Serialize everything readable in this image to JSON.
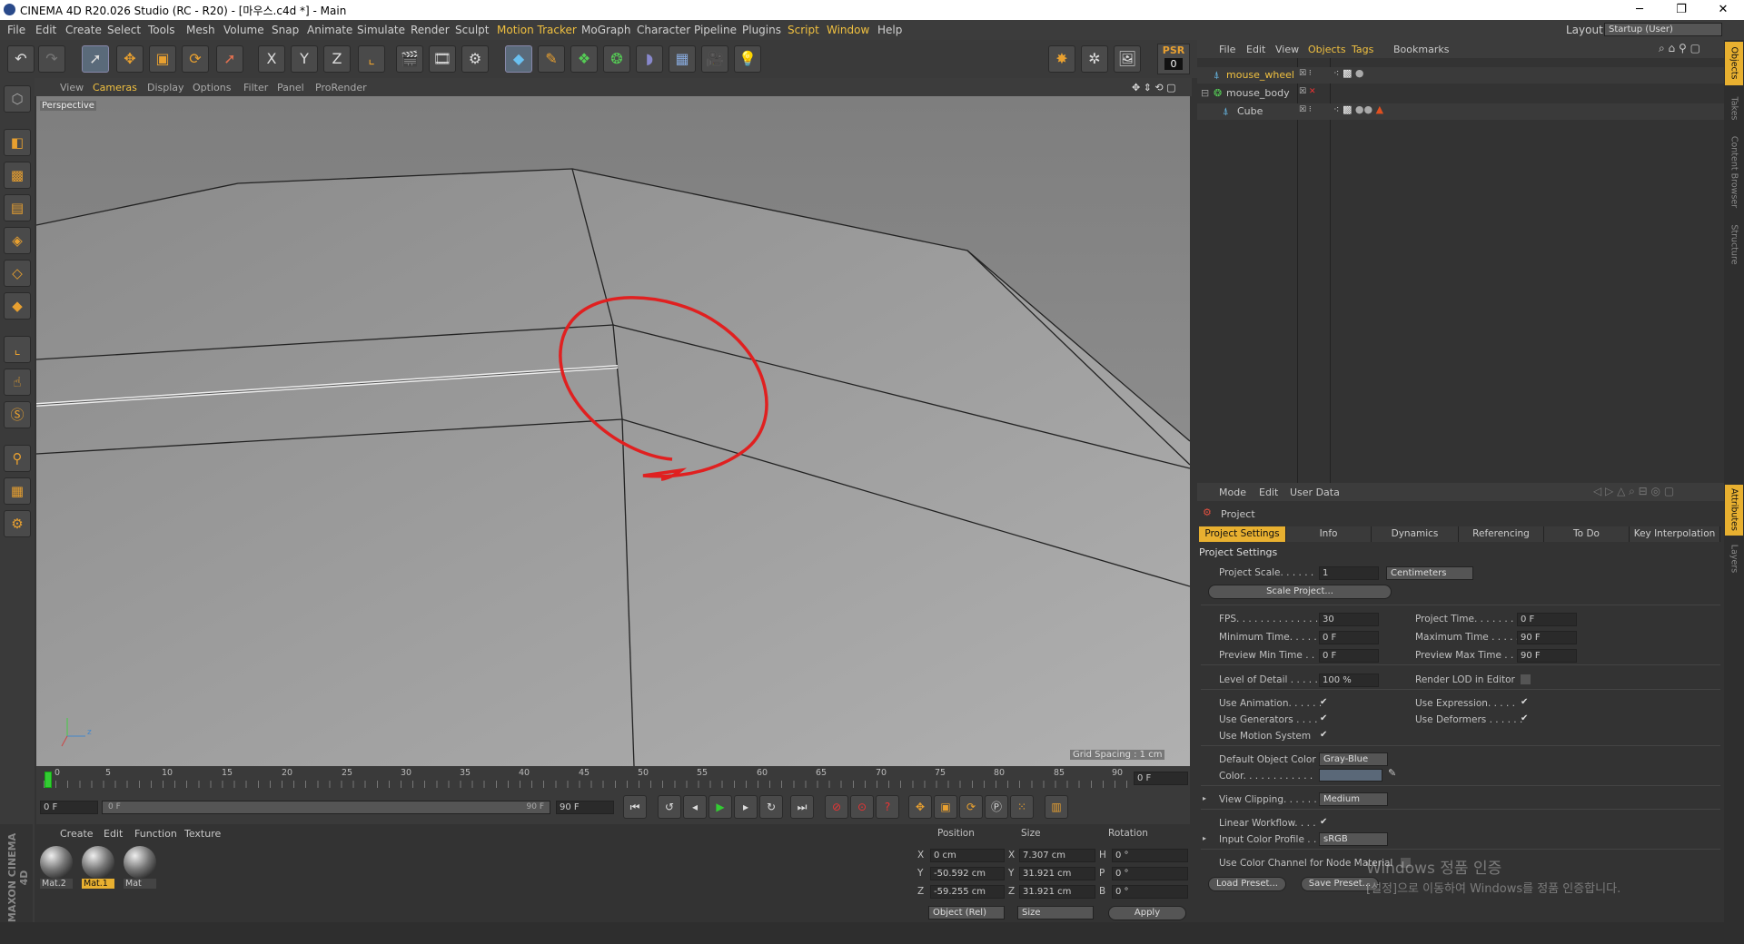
{
  "window": {
    "title": "CINEMA 4D R20.026 Studio (RC - R20) - [마우스.c4d *] - Main",
    "controls": [
      "─",
      "❐",
      "✕"
    ]
  },
  "menu": {
    "items": [
      "File",
      "Edit",
      "Create",
      "Select",
      "Tools",
      "Mesh",
      "Volume",
      "Snap",
      "Animate",
      "Simulate",
      "Render",
      "Sculpt",
      "Motion Tracker",
      "MoGraph",
      "Character",
      "Pipeline",
      "Plugins",
      "Script",
      "Window",
      "Help"
    ],
    "layout_label": "Layout:",
    "layout_value": "Startup (User)"
  },
  "toolbar": {
    "buttons": [
      "undo",
      "redo",
      "live-selection",
      "move",
      "scale",
      "rotate",
      "recent-tool",
      "x-axis",
      "y-axis",
      "z-axis",
      "coordinate-system",
      "render-view",
      "render-picture-viewer",
      "edit-render-settings",
      "cube",
      "pen",
      "subdivision",
      "array",
      "deformer",
      "floor",
      "camera",
      "light"
    ],
    "axis_labels": [
      "X",
      "Y",
      "Z"
    ],
    "psr_label": "PSR",
    "psr_value": "0"
  },
  "viewport": {
    "menu": [
      "View",
      "Cameras",
      "Display",
      "Options",
      "Filter",
      "Panel",
      "ProRender"
    ],
    "camera": "Perspective",
    "grid_spacing": "Grid Spacing : 1 cm",
    "axis_z": "z"
  },
  "timeline": {
    "ticks": [
      "0",
      "5",
      "10",
      "15",
      "20",
      "25",
      "30",
      "35",
      "40",
      "45",
      "50",
      "55",
      "60",
      "65",
      "70",
      "75",
      "80",
      "85",
      "90"
    ],
    "current": "0 F",
    "start": "0 F",
    "range_start": "0 F",
    "range_end": "90 F",
    "end": "90 F"
  },
  "materials": {
    "menu": [
      "Create",
      "Edit",
      "Function",
      "Texture"
    ],
    "items": [
      {
        "name": "Mat.2",
        "selected": false
      },
      {
        "name": "Mat.1",
        "selected": true
      },
      {
        "name": "Mat",
        "selected": false
      }
    ],
    "brand": "MAXON CINEMA 4D"
  },
  "coords": {
    "headers": [
      "Position",
      "Size",
      "Rotation"
    ],
    "rows": [
      {
        "axis": "X",
        "pos": "0 cm",
        "saxis": "X",
        "size": "7.307 cm",
        "raxis": "H",
        "rot": "0 °"
      },
      {
        "axis": "Y",
        "pos": "-50.592 cm",
        "saxis": "Y",
        "size": "31.921 cm",
        "raxis": "P",
        "rot": "0 °"
      },
      {
        "axis": "Z",
        "pos": "-59.255 cm",
        "saxis": "Z",
        "size": "31.921 cm",
        "raxis": "B",
        "rot": "0 °"
      }
    ],
    "mode": "Object (Rel)",
    "size_mode": "Size",
    "apply": "Apply"
  },
  "objects": {
    "menu": [
      "File",
      "Edit",
      "View",
      "Objects",
      "Tags",
      "Bookmarks"
    ],
    "rows": [
      {
        "name": "mouse_wheel",
        "color": "#f0c040",
        "indent": 0
      },
      {
        "name": "mouse_body",
        "color": "#c8c8c8",
        "indent": 0
      },
      {
        "name": "Cube",
        "color": "#c8c8c8",
        "indent": 1
      }
    ]
  },
  "attributes": {
    "menu": [
      "Mode",
      "Edit",
      "User Data"
    ],
    "title": "Project",
    "tabs": [
      "Project Settings",
      "Info",
      "Dynamics",
      "Referencing",
      "To Do",
      "Key Interpolation"
    ],
    "section": "Project Settings",
    "project_scale_label": "Project Scale. . . . . .",
    "project_scale": "1",
    "units": "Centimeters",
    "scale_project": "Scale Project...",
    "fps_label": "FPS. . . . . . . . . . . . . . .",
    "fps": "30",
    "project_time_label": "Project Time. . . . . . . .",
    "project_time": "0 F",
    "min_time_label": "Minimum Time. . . . .",
    "min_time": "0 F",
    "max_time_label": "Maximum Time . . . . .",
    "max_time": "90 F",
    "prev_min_label": "Preview Min Time . .",
    "prev_min": "0 F",
    "prev_max_label": "Preview Max Time . . .",
    "prev_max": "90 F",
    "lod_label": "Level of Detail . . . . .",
    "lod": "100 %",
    "render_lod_label": "Render LOD in Editor",
    "use_anim_label": "Use Animation. . . . . .",
    "use_expr_label": "Use Expression. . . . .",
    "use_gen_label": "Use Generators . . . .",
    "use_def_label": "Use Deformers . . . . . .",
    "use_motion_label": "Use Motion System",
    "def_color_label": "Default Object Color",
    "def_color": "Gray-Blue",
    "color_label": "Color. . . . . . . . . . . .",
    "clipping_label": "View Clipping. . . . . .",
    "clipping": "Medium",
    "linear_label": "Linear Workflow. . . .",
    "input_profile_label": "Input Color Profile . .",
    "input_profile": "sRGB",
    "node_mat_label": "Use Color Channel for Node Material",
    "load_preset": "Load Preset...",
    "save_preset": "Save Preset...",
    "activation_title": "Windows 정품 인증",
    "activation_sub": "[설정]으로 이동하여 Windows를 정품 인증합니다."
  },
  "rightstrip": {
    "tabs": [
      "Objects",
      "Takes",
      "Content Browser",
      "Structure",
      "Attributes",
      "Layers"
    ]
  }
}
